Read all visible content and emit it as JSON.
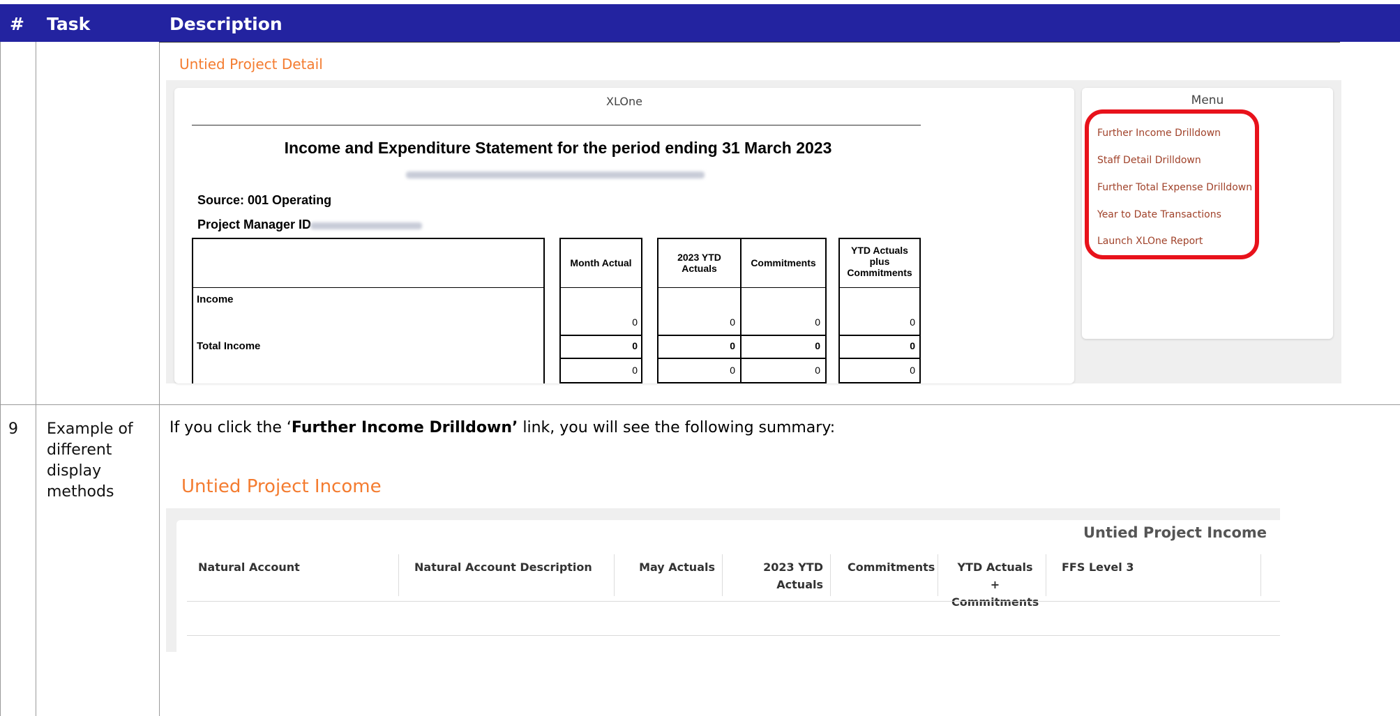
{
  "table": {
    "headers": {
      "num": "#",
      "task": "Task",
      "description": "Description"
    },
    "row9": {
      "number": "9",
      "task_lines": [
        "Example of",
        "different",
        "display",
        "methods"
      ]
    }
  },
  "screen1": {
    "page_title": "Untied Project Detail",
    "app_name": "XLOne",
    "statement_title": "Income and Expenditure Statement for the period ending 31 March 2023",
    "source": "Source: 001 Operating",
    "project_manager": "Project Manager ID",
    "columns": [
      "Month Actual",
      "2023 YTD Actuals",
      "Commitments",
      "YTD Actuals plus Commitments"
    ],
    "rows": [
      {
        "label": "Income",
        "values": [
          "0",
          "0",
          "0",
          "0"
        ]
      },
      {
        "label": "Total Income",
        "values": [
          "0",
          "0",
          "0",
          "0"
        ]
      },
      {
        "label": "",
        "values": [
          "0",
          "0",
          "0",
          "0"
        ]
      }
    ],
    "menu": {
      "title": "Menu",
      "items": [
        "Further Income Drilldown",
        "Staff Detail Drilldown",
        "Further Total Expense Drilldown",
        "Year to Date Transactions",
        "Launch XLOne Report"
      ],
      "highlight_color": "#e8121b"
    }
  },
  "row9_text": {
    "prefix": "If you click the ‘",
    "link": "Further Income Drilldown’",
    "suffix": " link, you will see the following summary:"
  },
  "screen2": {
    "page_title": "Untied Project Income",
    "panel_title": "Untied Project Income",
    "columns": [
      "Natural Account",
      "Natural Account Description",
      "May Actuals",
      "2023 YTD Actuals",
      "Commitments",
      "YTD Actuals + Commitments",
      "FFS Level 3"
    ]
  },
  "colors": {
    "header_bg": "#2323a0",
    "accent_orange": "#f47c30",
    "menu_link": "#a0422a"
  }
}
